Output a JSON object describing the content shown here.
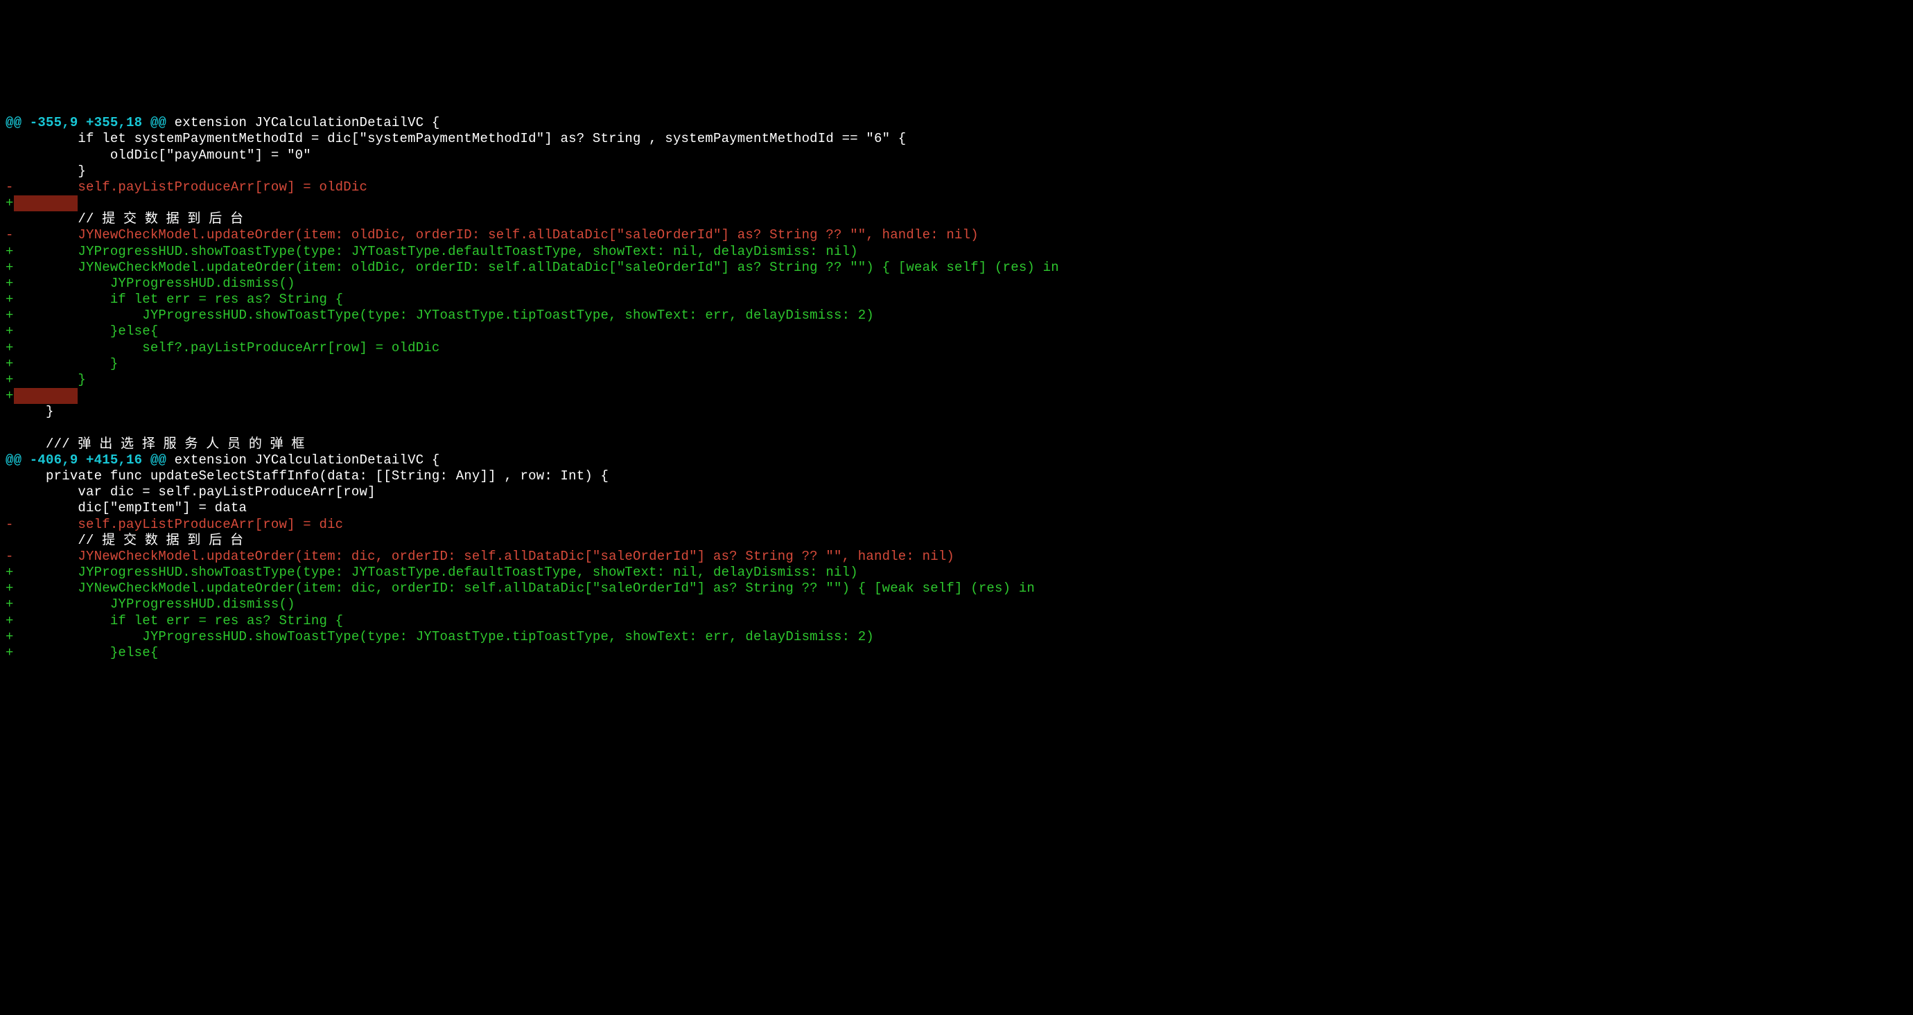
{
  "lines": [
    {
      "cls": "hunk",
      "text": "@@ -355,9 +355,18 @@ ",
      "tail": "extension JYCalculationDetailVC {",
      "tailCls": "ctx"
    },
    {
      "cls": "ctx",
      "text": "         if let systemPaymentMethodId = dic[\"systemPaymentMethodId\"] as? String , systemPaymentMethodId == \"6\" {"
    },
    {
      "cls": "ctx",
      "text": "             oldDic[\"payAmount\"] = \"0\""
    },
    {
      "cls": "ctx",
      "text": "         }"
    },
    {
      "cls": "del",
      "text": "-        self.payListProduceArr[row] = oldDic"
    },
    {
      "cls": "add",
      "text": "+",
      "ws": "        "
    },
    {
      "cls": "ctx",
      "text": "         // 提 交 数 据 到 后 台"
    },
    {
      "cls": "del",
      "text": "-        JYNewCheckModel.updateOrder(item: oldDic, orderID: self.allDataDic[\"saleOrderId\"] as? String ?? \"\", handle: nil)"
    },
    {
      "cls": "add",
      "text": "+        JYProgressHUD.showToastType(type: JYToastType.defaultToastType, showText: nil, delayDismiss: nil)"
    },
    {
      "cls": "add",
      "text": "+        JYNewCheckModel.updateOrder(item: oldDic, orderID: self.allDataDic[\"saleOrderId\"] as? String ?? \"\") { [weak self] (res) in"
    },
    {
      "cls": "add",
      "text": "+            JYProgressHUD.dismiss()"
    },
    {
      "cls": "add",
      "text": "+            if let err = res as? String {"
    },
    {
      "cls": "add",
      "text": "+                JYProgressHUD.showToastType(type: JYToastType.tipToastType, showText: err, delayDismiss: 2)"
    },
    {
      "cls": "add",
      "text": "+            }else{"
    },
    {
      "cls": "add",
      "text": "+                self?.payListProduceArr[row] = oldDic"
    },
    {
      "cls": "add",
      "text": "+            }"
    },
    {
      "cls": "add",
      "text": "+        }"
    },
    {
      "cls": "add",
      "text": "+",
      "ws": "        "
    },
    {
      "cls": "ctx",
      "text": "     }"
    },
    {
      "cls": "ctx",
      "text": " "
    },
    {
      "cls": "ctx",
      "text": "     /// 弹 出 选 择 服 务 人 员 的 弹 框"
    },
    {
      "cls": "hunk",
      "text": "@@ -406,9 +415,16 @@ ",
      "tail": "extension JYCalculationDetailVC {",
      "tailCls": "ctx"
    },
    {
      "cls": "ctx",
      "text": "     private func updateSelectStaffInfo(data: [[String: Any]] , row: Int) {"
    },
    {
      "cls": "ctx",
      "text": "         var dic = self.payListProduceArr[row]"
    },
    {
      "cls": "ctx",
      "text": "         dic[\"empItem\"] = data"
    },
    {
      "cls": "del",
      "text": "-        self.payListProduceArr[row] = dic"
    },
    {
      "cls": "ctx",
      "text": "         // 提 交 数 据 到 后 台"
    },
    {
      "cls": "del",
      "text": "-        JYNewCheckModel.updateOrder(item: dic, orderID: self.allDataDic[\"saleOrderId\"] as? String ?? \"\", handle: nil)"
    },
    {
      "cls": "add",
      "text": "+        JYProgressHUD.showToastType(type: JYToastType.defaultToastType, showText: nil, delayDismiss: nil)"
    },
    {
      "cls": "add",
      "text": "+        JYNewCheckModel.updateOrder(item: dic, orderID: self.allDataDic[\"saleOrderId\"] as? String ?? \"\") { [weak self] (res) in"
    },
    {
      "cls": "add",
      "text": "+            JYProgressHUD.dismiss()"
    },
    {
      "cls": "add",
      "text": "+            if let err = res as? String {"
    },
    {
      "cls": "add",
      "text": "+                JYProgressHUD.showToastType(type: JYToastType.tipToastType, showText: err, delayDismiss: 2)"
    },
    {
      "cls": "add",
      "text": "+            }else{"
    }
  ]
}
